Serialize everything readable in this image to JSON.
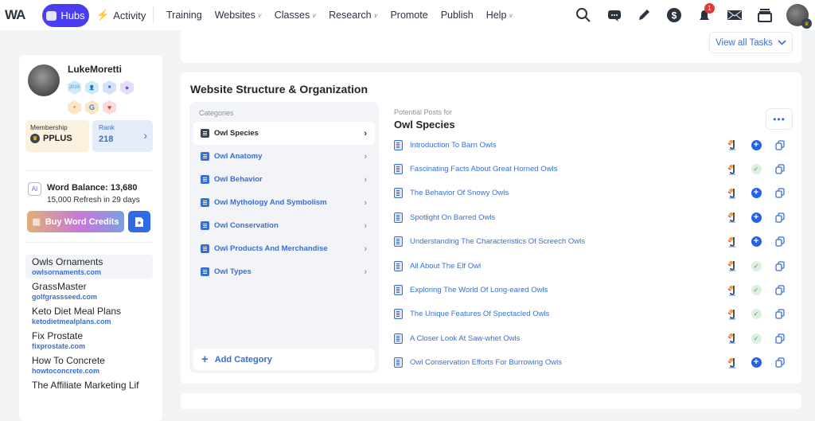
{
  "topbar": {
    "logo": "WA",
    "hubs_label": "Hubs",
    "activity_label": "Activity",
    "nav": [
      {
        "label": "Training",
        "dropdown": false
      },
      {
        "label": "Websites",
        "dropdown": true
      },
      {
        "label": "Classes",
        "dropdown": true
      },
      {
        "label": "Research",
        "dropdown": true
      },
      {
        "label": "Promote",
        "dropdown": false
      },
      {
        "label": "Publish",
        "dropdown": false
      },
      {
        "label": "Help",
        "dropdown": true
      }
    ],
    "notification_count": "1"
  },
  "profile": {
    "username": "LukeMoretti",
    "badges": [
      "2016",
      "user",
      "screen",
      "diamond",
      "medal",
      "G",
      "heart"
    ],
    "membership_label": "Membership",
    "membership_value": "PPLUS",
    "rank_label": "Rank",
    "rank_value": "218"
  },
  "words": {
    "ai_label": "AI",
    "balance": "Word Balance: 13,680",
    "refresh": "15,000 Refresh in 29 days",
    "buy_label": "Buy Word Credits"
  },
  "sites": [
    {
      "name": "Owls Ornaments",
      "domain": "owlsornaments.com",
      "active": true
    },
    {
      "name": "GrassMaster",
      "domain": "golfgrassseed.com"
    },
    {
      "name": "Keto Diet Meal Plans",
      "domain": "ketodietmealplans.com"
    },
    {
      "name": "Fix Prostate",
      "domain": "fixprostate.com"
    },
    {
      "name": "How To Concrete",
      "domain": "howtoconcrete.com"
    },
    {
      "name": "The Affiliate Marketing Lif",
      "domain": ""
    }
  ],
  "tasks": {
    "view_all_label": "View all Tasks"
  },
  "structure": {
    "title": "Website Structure & Organization",
    "categories_header": "Categories",
    "categories": [
      "Owl Species",
      "Owl Anatomy",
      "Owl Behavior",
      "Owl Mythology And Symbolism",
      "Owl Conservation",
      "Owl Products And Merchandise",
      "Owl Types"
    ],
    "active_category": 0,
    "add_category_label": "Add Category",
    "posts_label": "Potential Posts for",
    "posts_title": "Owl Species",
    "more_label": "•••",
    "posts": [
      {
        "title": "Introduction To Barn Owls",
        "status": "add"
      },
      {
        "title": "Fascinating Facts About Great Horned Owls",
        "status": "done"
      },
      {
        "title": "The Behavior Of Snowy Owls",
        "status": "add"
      },
      {
        "title": "Spotlight On Barred Owls",
        "status": "add"
      },
      {
        "title": "Understanding The Characteristics Of Screech Owls",
        "status": "add"
      },
      {
        "title": "All About The Elf Owl",
        "status": "done"
      },
      {
        "title": "Exploring The World Of Long-eared Owls",
        "status": "done"
      },
      {
        "title": "The Unique Features Of Spectacled Owls",
        "status": "done"
      },
      {
        "title": "A Closer Look At Saw-whet Owls",
        "status": "done"
      },
      {
        "title": "Owl Conservation Efforts For Burrowing Owls",
        "status": "add"
      }
    ]
  }
}
